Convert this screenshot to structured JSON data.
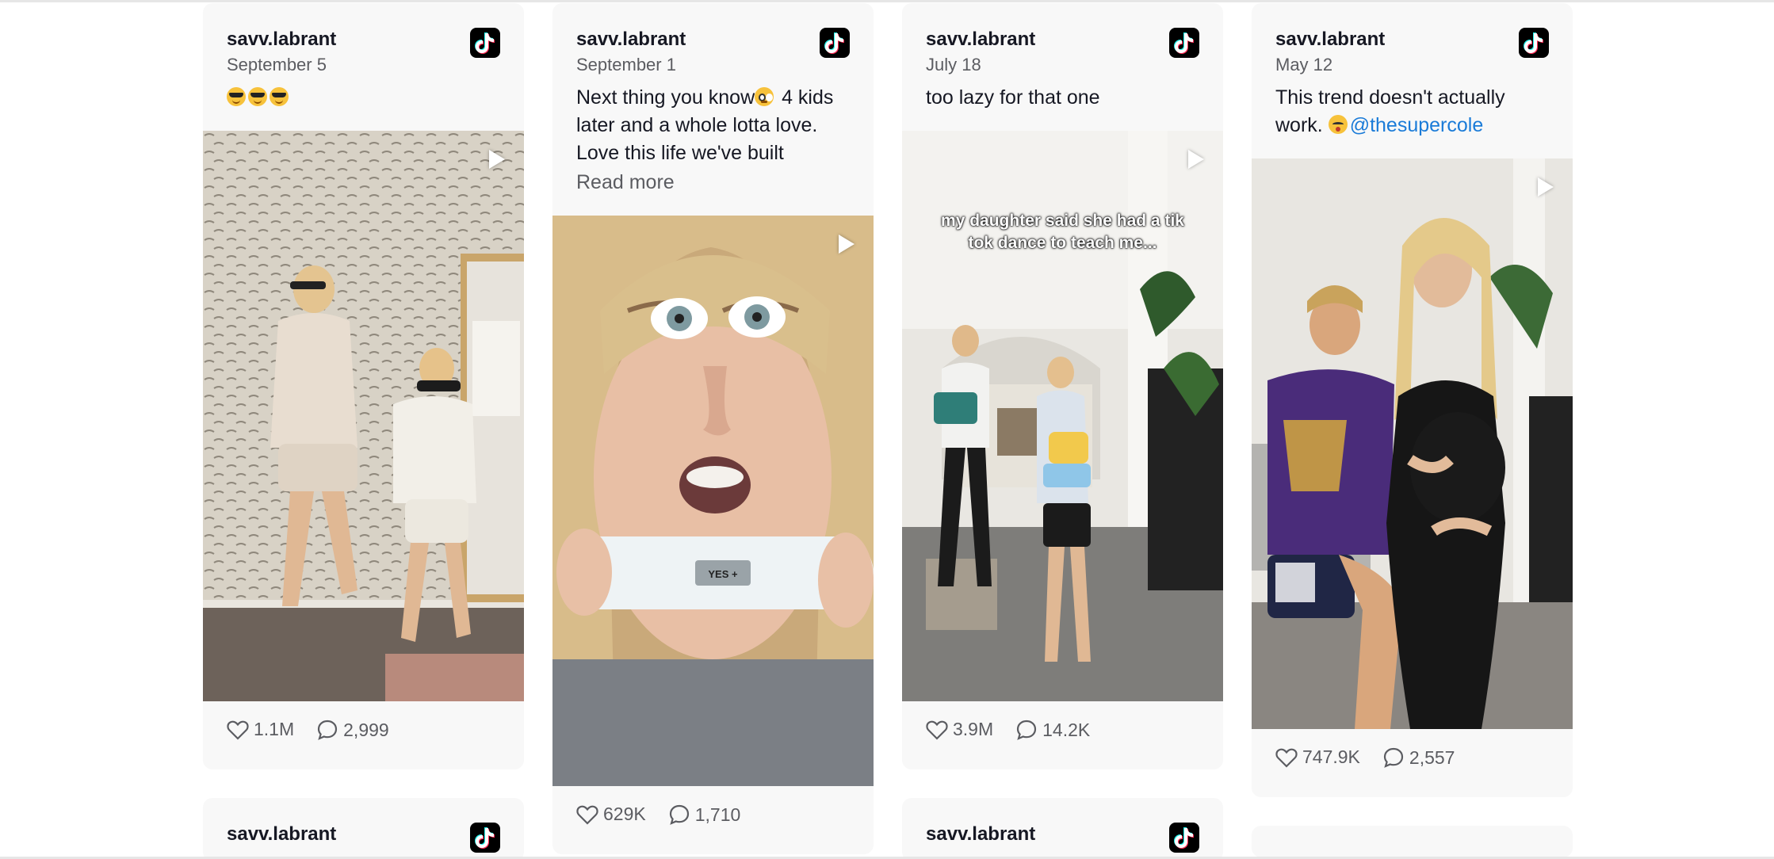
{
  "posts": [
    {
      "username": "savv.labrant",
      "date": "September 5",
      "caption": "",
      "emoji": [
        "sunglasses",
        "sunglasses",
        "sunglasses"
      ],
      "likes": "1.1M",
      "comments": "2,999",
      "overlay": ""
    },
    {
      "username": "savv.labrant",
      "date": "September 1",
      "caption_part1": "Next thing you know",
      "caption_part2": " 4 kids later and a whole lotta love. Love this life we've built",
      "read_more": "Read more",
      "likes": "629K",
      "comments": "1,710",
      "test_label": "YES +"
    },
    {
      "username": "savv.labrant",
      "date": "July 18",
      "caption": "too lazy for that one",
      "likes": "3.9M",
      "comments": "14.2K",
      "overlay": "my daughter said she had a tik tok dance to teach me..."
    },
    {
      "username": "savv.labrant",
      "date": "May 12",
      "caption": "This trend doesn't actually work. ",
      "mention": "@thesupercole",
      "likes": "747.9K",
      "comments": "2,557"
    }
  ],
  "next_row": [
    {
      "username": "savv.labrant"
    },
    {
      "username": "savv.labrant"
    }
  ],
  "colors": {
    "card_bg": "#f8f8f8",
    "text": "#161823",
    "secondary": "#5b5c61",
    "mention": "#1a7bd8"
  }
}
